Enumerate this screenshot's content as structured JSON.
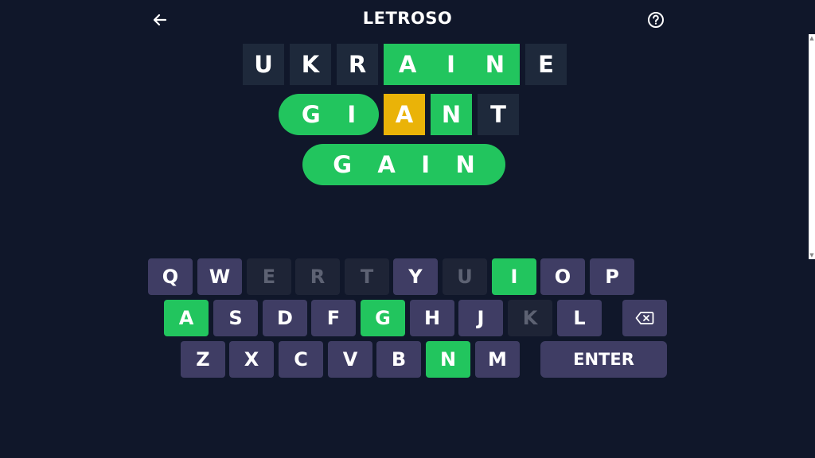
{
  "header": {
    "title": "LETROSO",
    "back_icon": "arrow-left-icon",
    "help_icon": "help-circle-icon"
  },
  "colors": {
    "background": "#10172a",
    "tile_empty": "#1e293b",
    "correct": "#22c55e",
    "present": "#eab308",
    "key": "#3f3d64",
    "key_absent": "#1e2436"
  },
  "board": {
    "row1": [
      "U",
      "K",
      "R",
      "A",
      "I",
      "N",
      "E"
    ],
    "row1_states": [
      "empty",
      "empty",
      "empty",
      "correct",
      "correct",
      "correct",
      "empty"
    ],
    "row2": [
      "G",
      "I",
      "A",
      "N",
      "T"
    ],
    "row2_states": [
      "correct",
      "correct",
      "present",
      "correct",
      "empty"
    ],
    "row3": [
      "G",
      "A",
      "I",
      "N"
    ],
    "row3_states": [
      "correct",
      "correct",
      "correct",
      "correct"
    ]
  },
  "keyboard": {
    "row1": [
      "Q",
      "W",
      "E",
      "R",
      "T",
      "Y",
      "U",
      "I",
      "O",
      "P"
    ],
    "row1_states": [
      "normal",
      "normal",
      "absent",
      "absent",
      "absent",
      "normal",
      "absent",
      "correct",
      "normal",
      "normal"
    ],
    "row2": [
      "A",
      "S",
      "D",
      "F",
      "G",
      "H",
      "J",
      "K",
      "L"
    ],
    "row2_states": [
      "correct",
      "normal",
      "normal",
      "normal",
      "correct",
      "normal",
      "normal",
      "absent",
      "normal"
    ],
    "row3": [
      "Z",
      "X",
      "C",
      "V",
      "B",
      "N",
      "M"
    ],
    "row3_states": [
      "normal",
      "normal",
      "normal",
      "normal",
      "normal",
      "correct",
      "normal"
    ],
    "backspace_icon": "backspace-icon",
    "enter_label": "ENTER"
  }
}
